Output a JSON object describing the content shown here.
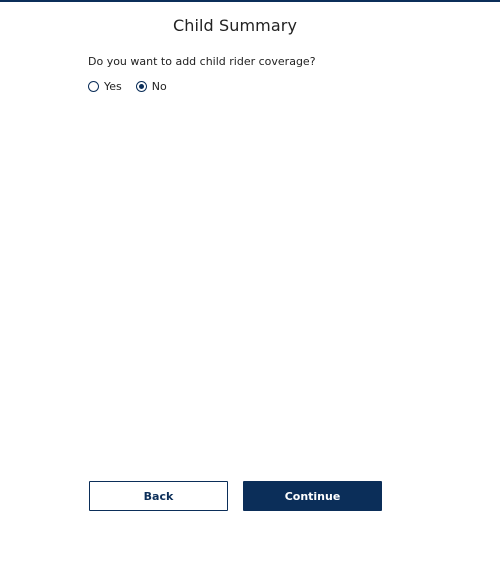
{
  "page": {
    "title": "Child Summary"
  },
  "question": {
    "text": "Do you want to add child rider coverage?",
    "options": [
      {
        "label": "Yes",
        "selected": false
      },
      {
        "label": "No",
        "selected": true
      }
    ]
  },
  "footer": {
    "back_label": "Back",
    "continue_label": "Continue"
  },
  "colors": {
    "primary": "#0b2e59",
    "text": "#222222",
    "background": "#ffffff"
  }
}
